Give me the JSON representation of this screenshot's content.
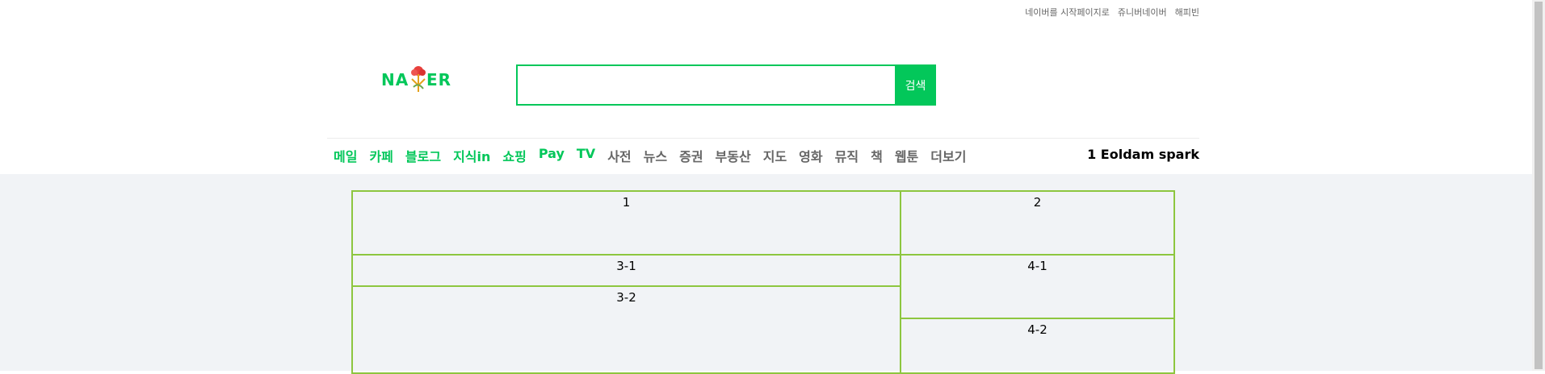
{
  "top_links": [
    "네이버를 시작페이지로",
    "쥬니버네이버",
    "해피빈"
  ],
  "logo": {
    "alt": "NAVER"
  },
  "search": {
    "placeholder": "",
    "value": "",
    "button_label": "검색"
  },
  "nav": {
    "items": [
      {
        "label": "메일",
        "style": "green"
      },
      {
        "label": "카페",
        "style": "green"
      },
      {
        "label": "블로그",
        "style": "green"
      },
      {
        "label": "지식in",
        "style": "green"
      },
      {
        "label": "쇼핑",
        "style": "green"
      },
      {
        "label": "Pay",
        "style": "green"
      },
      {
        "label": "TV",
        "style": "green"
      },
      {
        "label": "사전",
        "style": "gray"
      },
      {
        "label": "뉴스",
        "style": "gray"
      },
      {
        "label": "증권",
        "style": "gray"
      },
      {
        "label": "부동산",
        "style": "gray"
      },
      {
        "label": "지도",
        "style": "gray"
      },
      {
        "label": "영화",
        "style": "gray"
      },
      {
        "label": "뮤직",
        "style": "gray"
      },
      {
        "label": "책",
        "style": "gray"
      },
      {
        "label": "웹툰",
        "style": "gray"
      },
      {
        "label": "더보기",
        "style": "gray"
      }
    ],
    "right_text": "1 Eoldam spark"
  },
  "grid": {
    "cell_1": "1",
    "cell_2": "2",
    "cell_3_1": "3-1",
    "cell_3_2": "3-2",
    "cell_4_1": "4-1",
    "cell_4_2": "4-2"
  },
  "colors": {
    "accent": "#03c75a",
    "border": "#8dc63f",
    "content_bg": "#f1f3f6"
  }
}
